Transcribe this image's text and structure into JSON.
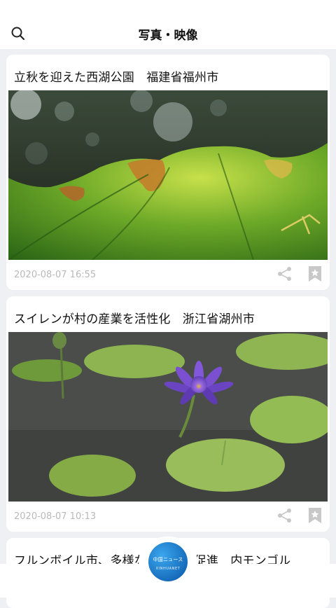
{
  "header": {
    "title": "写真・映像",
    "search_icon": "search-icon"
  },
  "articles": [
    {
      "title": "立秋を迎えた西湖公園　福建省福州市",
      "date": "2020-08-07 16:55",
      "image": "green lotus leaf with brown spots, bokeh background",
      "share_icon": "share-icon",
      "bookmark_icon": "bookmark-star-icon"
    },
    {
      "title": "スイレンが村の産業を活性化　浙江省湖州市",
      "date": "2020-08-07 10:13",
      "image": "purple water lily among lily pads on dark pond",
      "share_icon": "share-icon",
      "bookmark_icon": "bookmark-star-icon"
    },
    {
      "title": "フルンボイル市、多様な　　観光促進　内モンゴル"
    }
  ],
  "bottom_nav": {
    "logo_text": "中国ニュース",
    "logo_subtext": "XINHUANET"
  },
  "colors": {
    "background": "#eef0f4",
    "card": "#ffffff",
    "date_text": "#b9b9b9",
    "icon": "#c8c8c8",
    "logo_blue": "#1a78cc"
  }
}
